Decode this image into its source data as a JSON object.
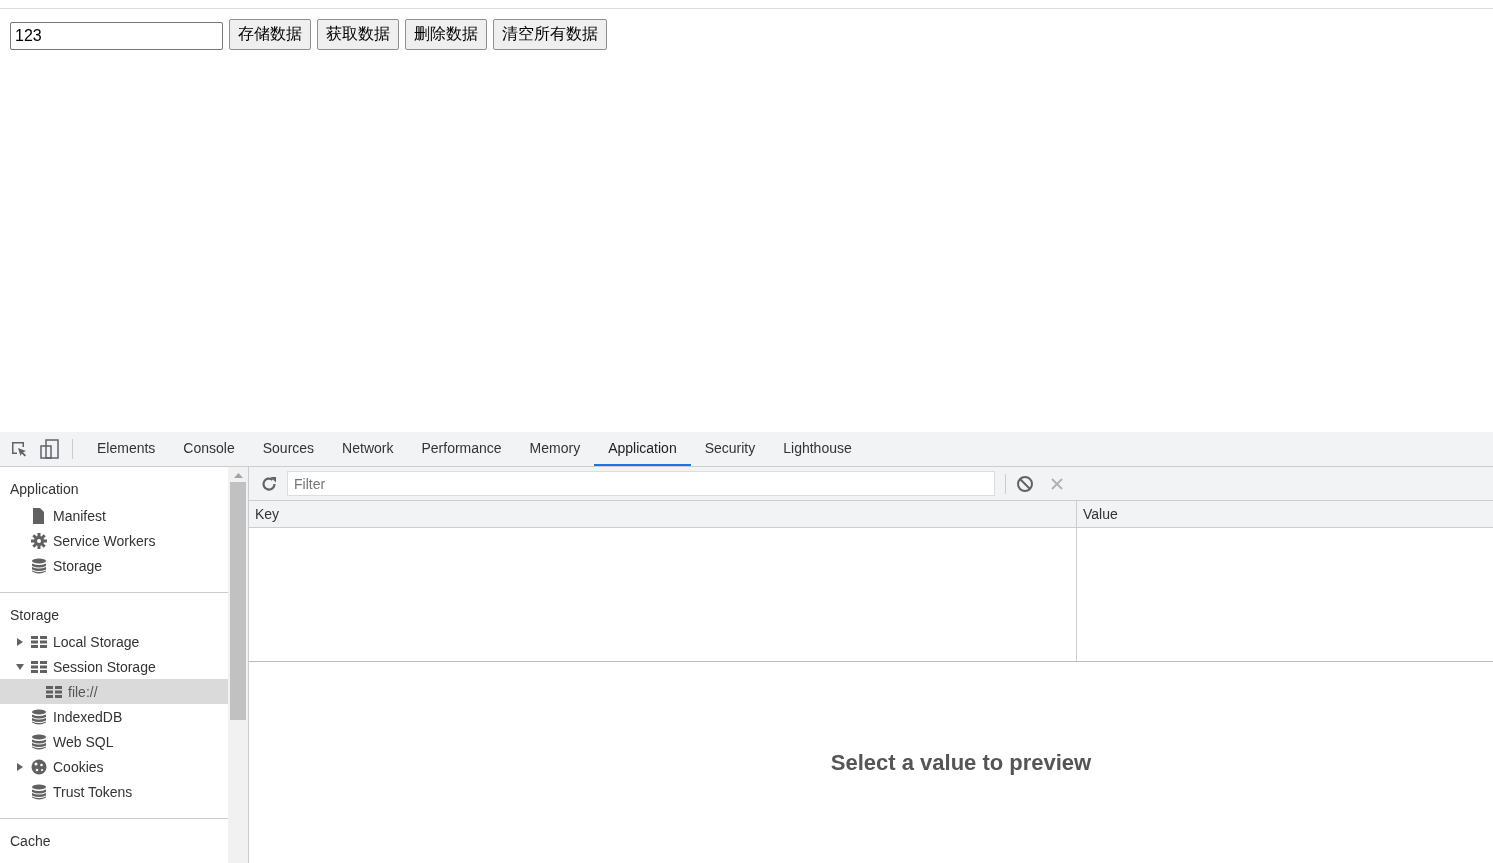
{
  "page": {
    "input": {
      "value": "123"
    },
    "buttons": [
      "存储数据",
      "获取数据",
      "删除数据",
      "清空所有数据"
    ]
  },
  "devtools": {
    "tabs": [
      {
        "label": "Elements",
        "selected": false
      },
      {
        "label": "Console",
        "selected": false
      },
      {
        "label": "Sources",
        "selected": false
      },
      {
        "label": "Network",
        "selected": false
      },
      {
        "label": "Performance",
        "selected": false
      },
      {
        "label": "Memory",
        "selected": false
      },
      {
        "label": "Application",
        "selected": true
      },
      {
        "label": "Security",
        "selected": false
      },
      {
        "label": "Lighthouse",
        "selected": false
      }
    ],
    "sidebar": {
      "sections": [
        {
          "title": "Application",
          "items": [
            {
              "label": "Manifest",
              "kind": "file",
              "selected": false
            },
            {
              "label": "Service Workers",
              "kind": "gear",
              "selected": false
            },
            {
              "label": "Storage",
              "kind": "database",
              "selected": false
            }
          ]
        },
        {
          "title": "Storage",
          "items": [
            {
              "label": "Local Storage",
              "kind": "table",
              "selected": false,
              "expanded": false
            },
            {
              "label": "Session Storage",
              "kind": "table",
              "selected": false,
              "expanded": true,
              "children": [
                {
                  "label": "file://",
                  "kind": "table",
                  "selected": true
                }
              ]
            },
            {
              "label": "IndexedDB",
              "kind": "database",
              "selected": false
            },
            {
              "label": "Web SQL",
              "kind": "database",
              "selected": false
            },
            {
              "label": "Cookies",
              "kind": "cookie",
              "selected": false,
              "expanded": false
            },
            {
              "label": "Trust Tokens",
              "kind": "database",
              "selected": false
            }
          ]
        },
        {
          "title": "Cache"
        }
      ]
    },
    "toolbar": {
      "filter": {
        "placeholder": "Filter"
      },
      "clear_disabled": true
    },
    "table": {
      "columns": [
        "Key",
        "Value"
      ]
    },
    "preview": {
      "message": "Select a value to preview"
    }
  }
}
